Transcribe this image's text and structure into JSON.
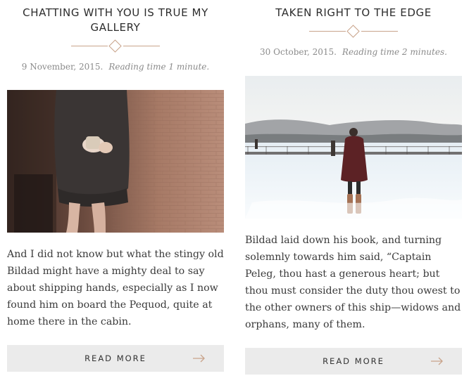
{
  "posts": [
    {
      "title": "CHATTING WITH YOU IS TRUE MY GALLERY",
      "date": "9 November, 2015.",
      "reading_time": "Reading time 1 minute.",
      "image_alt": "woman in sweater holding a cup",
      "excerpt": "And I did not know but what the stingy old Bildad might have a mighty deal to say about shipping hands, especially as I now found him on board the Pequod, quite at home there in the cabin.",
      "button_label": "READ MORE"
    },
    {
      "title": "TAKEN RIGHT TO THE EDGE",
      "date": "30 October, 2015.",
      "reading_time": "Reading time 2 minutes.",
      "image_alt": "person walking on snowy frozen lake",
      "excerpt": "Bildad laid down his book, and turning solemnly towards him said, “Captain Peleg, thou hast a generous heart; but thou must consider the duty thou owest to the other owners of this ship—widows and orphans, many of them.",
      "button_label": "READ MORE"
    }
  ],
  "accent_color": "#c9a48b",
  "icons": {
    "read_more": "arrow-right-icon",
    "divider": "diamond-icon"
  }
}
